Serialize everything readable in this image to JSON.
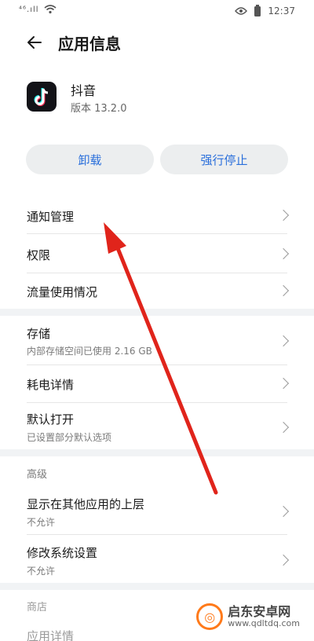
{
  "status_bar": {
    "signal": "⁴⁶.ıll",
    "time": "12:37"
  },
  "header": {
    "title": "应用信息"
  },
  "app": {
    "name": "抖音",
    "version": "版本 13.2.0"
  },
  "actions": {
    "uninstall": "卸载",
    "force_stop": "强行停止"
  },
  "section1": {
    "items": [
      {
        "title": "通知管理"
      },
      {
        "title": "权限"
      },
      {
        "title": "流量使用情况"
      }
    ]
  },
  "section2": {
    "items": [
      {
        "title": "存储",
        "subtitle": "内部存储空间已使用 2.16 GB"
      },
      {
        "title": "耗电详情"
      },
      {
        "title": "默认打开",
        "subtitle": "已设置部分默认选项"
      }
    ]
  },
  "advanced": {
    "header": "高级",
    "items": [
      {
        "title": "显示在其他应用的上层",
        "subtitle": "不允许"
      },
      {
        "title": "修改系统设置",
        "subtitle": "不允许"
      }
    ]
  },
  "store": {
    "header": "商店",
    "items": [
      {
        "title": "应用详情"
      }
    ]
  },
  "watermark": {
    "name": "启东安卓网",
    "url": "www.qdltdq.com"
  },
  "colors": {
    "accent": "#2a6fdb",
    "annotation_arrow": "#e0241b",
    "background": "#f1f3f5"
  }
}
